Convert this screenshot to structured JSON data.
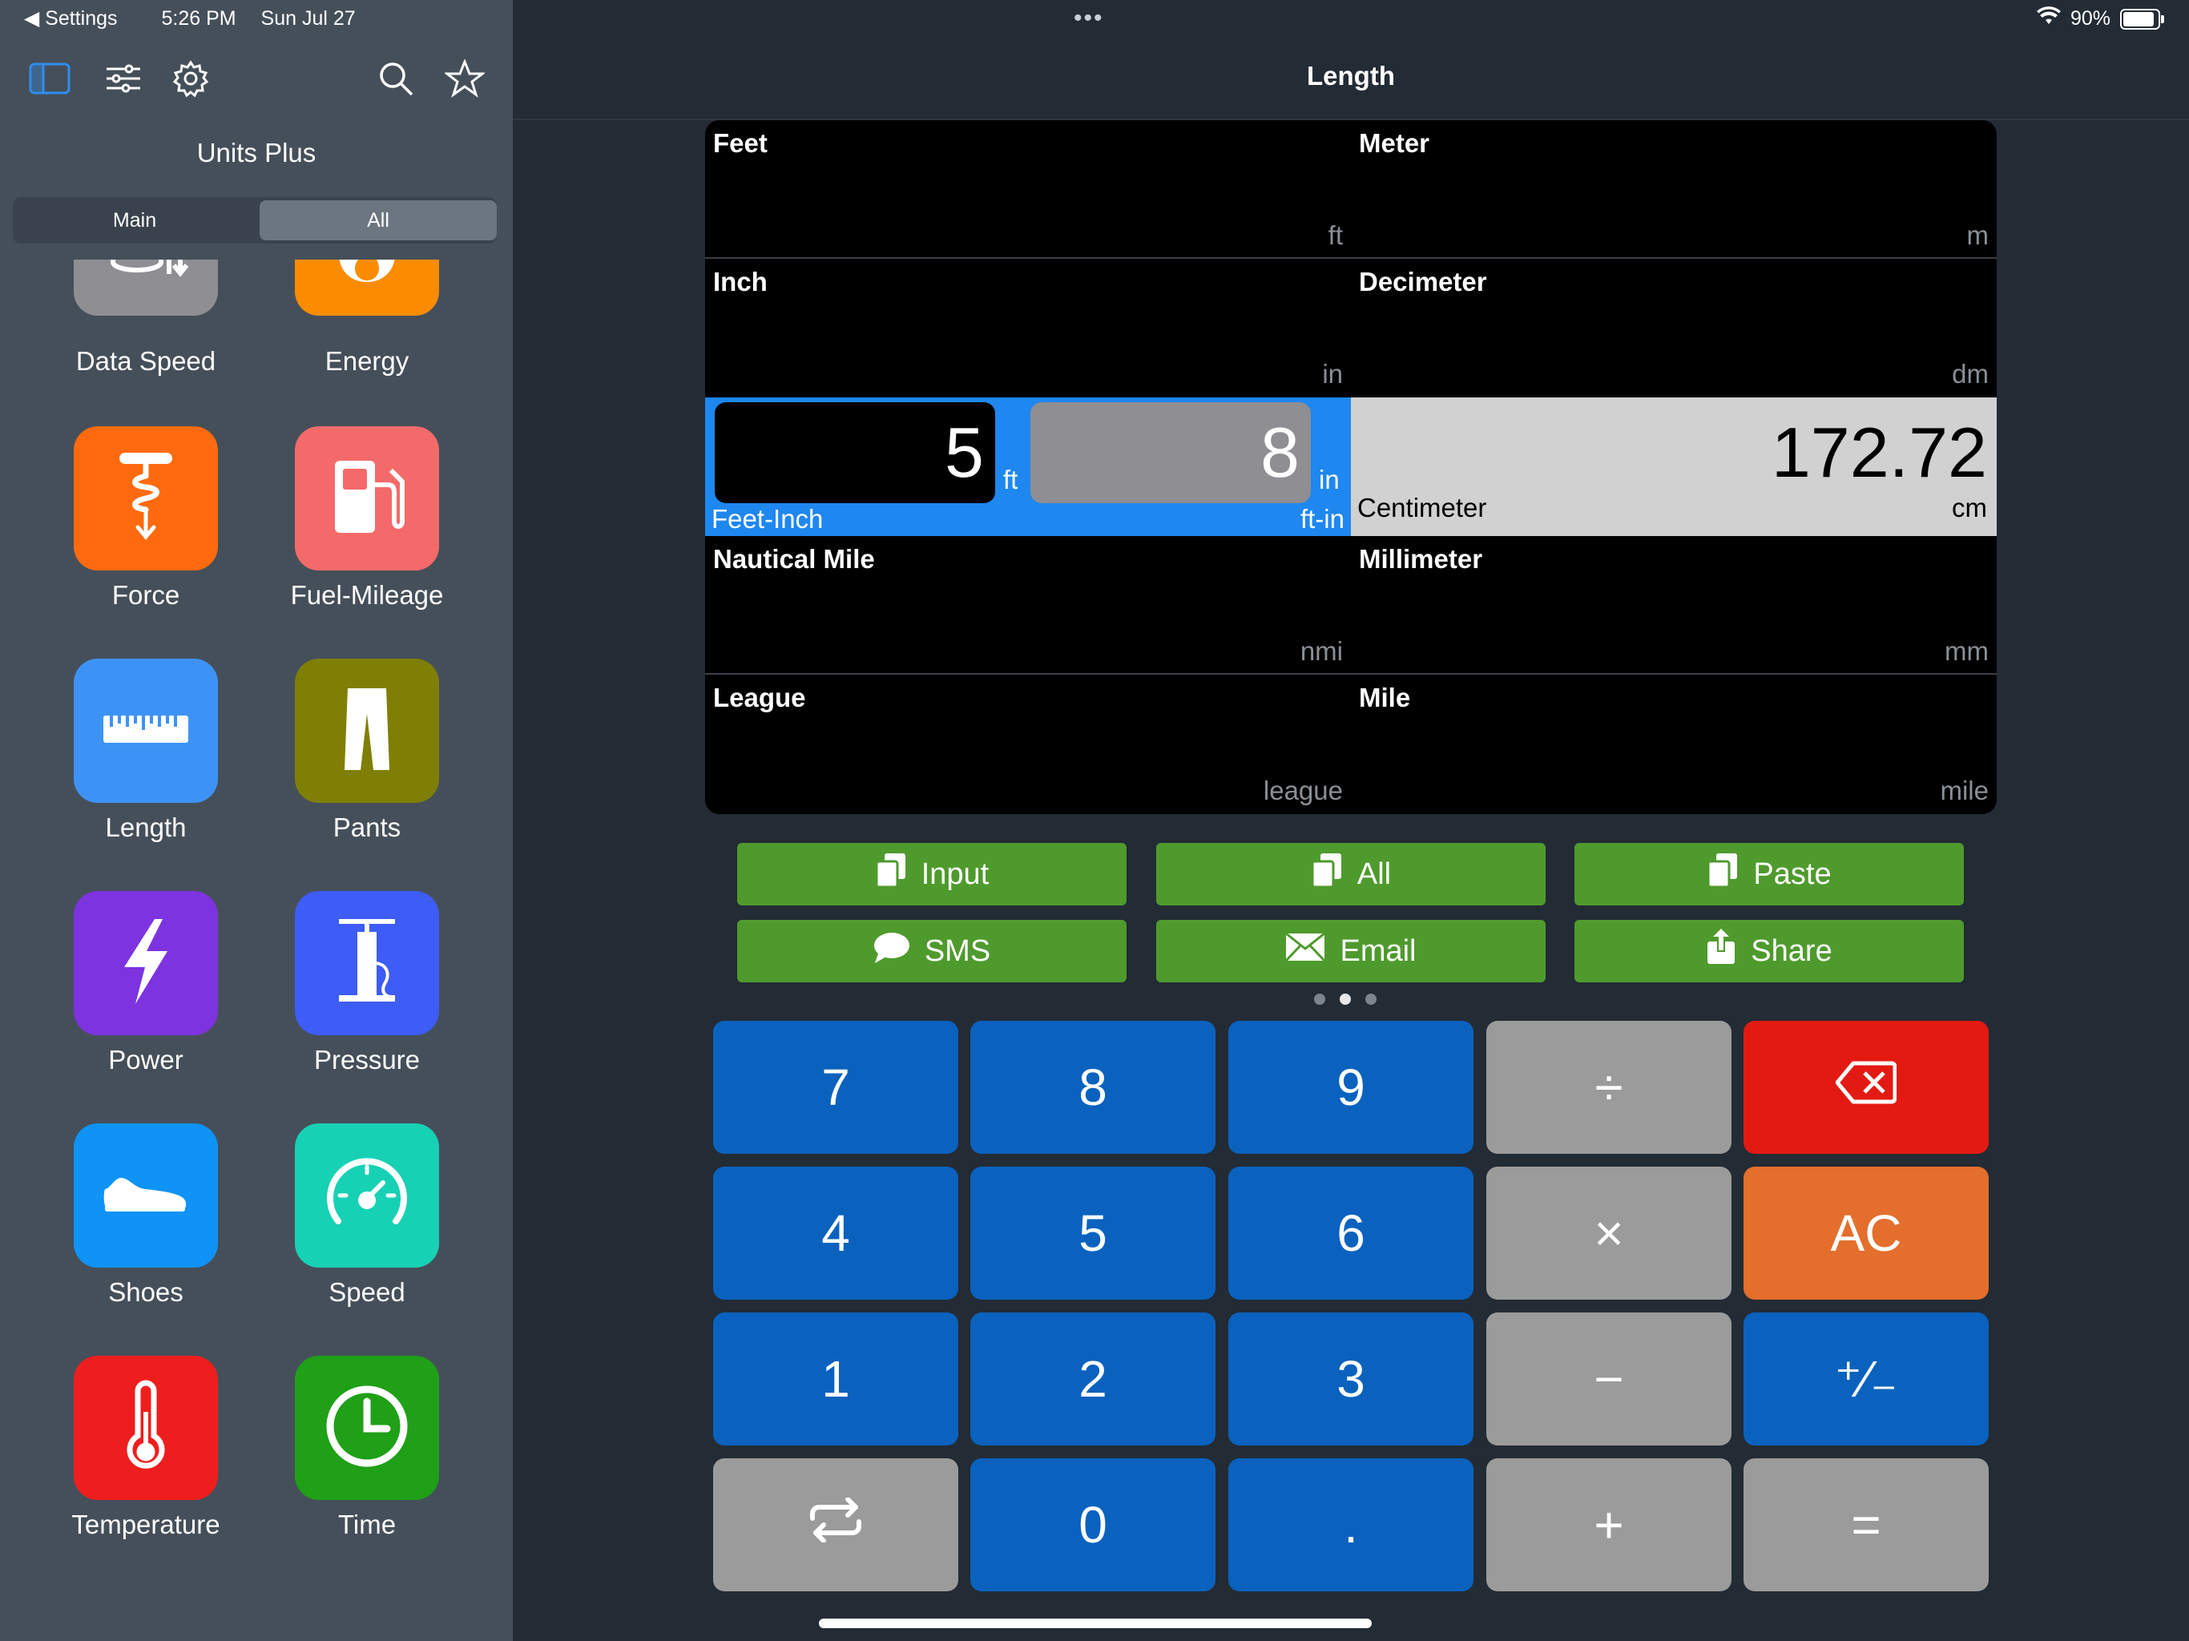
{
  "status_bar": {
    "back_app": "Settings",
    "time": "5:26 PM",
    "date": "Sun Jul 27",
    "battery": "90%",
    "center_dots": "•••"
  },
  "sidebar": {
    "title": "Units Plus",
    "segments": {
      "main": "Main",
      "all": "All"
    },
    "tiles": [
      {
        "label": "Data Speed",
        "icon": "database-arrows-icon",
        "color": "#8e8e93"
      },
      {
        "label": "Energy",
        "icon": "flame-icon",
        "color": "#fb8c00"
      },
      {
        "label": "Force",
        "icon": "corkscrew-icon",
        "color": "#ff6a0e"
      },
      {
        "label": "Fuel-Mileage",
        "icon": "fuel-pump-icon",
        "color": "#f46a6a"
      },
      {
        "label": "Length",
        "icon": "ruler-icon",
        "color": "#3d93f5"
      },
      {
        "label": "Pants",
        "icon": "pants-icon",
        "color": "#7f7f06"
      },
      {
        "label": "Power",
        "icon": "lightning-icon",
        "color": "#7e33e0"
      },
      {
        "label": "Pressure",
        "icon": "pump-icon",
        "color": "#3e5cf6"
      },
      {
        "label": "Shoes",
        "icon": "shoe-icon",
        "color": "#0f93f7"
      },
      {
        "label": "Speed",
        "icon": "speedometer-icon",
        "color": "#17d1b5"
      },
      {
        "label": "Temperature",
        "icon": "thermometer-icon",
        "color": "#ef1e1e"
      },
      {
        "label": "Time",
        "icon": "clock-icon",
        "color": "#1fa017"
      }
    ]
  },
  "main": {
    "title": "Length",
    "units": {
      "feet": {
        "name": "Feet",
        "unit": "ft"
      },
      "meter": {
        "name": "Meter",
        "unit": "m"
      },
      "inch": {
        "name": "Inch",
        "unit": "in"
      },
      "decimeter": {
        "name": "Decimeter",
        "unit": "dm"
      },
      "feet_inch": {
        "name": "Feet-Inch",
        "unit": "ft-in",
        "ft_value": "5",
        "ft_unit": "ft",
        "in_value": "8",
        "in_unit": "in"
      },
      "centimeter": {
        "name": "Centimeter",
        "unit": "cm",
        "value": "172.72"
      },
      "nautical_mile": {
        "name": "Nautical Mile",
        "unit": "nmi"
      },
      "millimeter": {
        "name": "Millimeter",
        "unit": "mm"
      },
      "league": {
        "name": "League",
        "unit": "league"
      },
      "mile": {
        "name": "Mile",
        "unit": "mile"
      }
    },
    "actions": {
      "input": "Input",
      "all": "All",
      "paste": "Paste",
      "sms": "SMS",
      "email": "Email",
      "share": "Share"
    },
    "keypad": {
      "k7": "7",
      "k8": "8",
      "k9": "9",
      "div": "÷",
      "k4": "4",
      "k5": "5",
      "k6": "6",
      "mul": "×",
      "ac": "AC",
      "k1": "1",
      "k2": "2",
      "k3": "3",
      "minus": "−",
      "plusminus": "⁺∕₋",
      "k0": "0",
      "dot": ".",
      "plus": "+",
      "eq": "="
    }
  }
}
